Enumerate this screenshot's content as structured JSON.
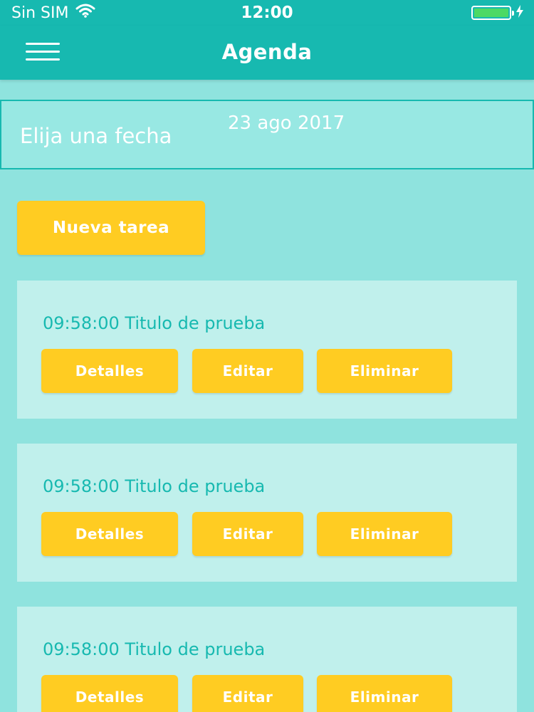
{
  "status_bar": {
    "carrier": "Sin SIM",
    "time": "12:00",
    "wifi_icon": "wifi-icon",
    "battery_icon": "battery-icon",
    "charging_icon": "lightning-icon",
    "battery_level": 1.0
  },
  "header": {
    "title": "Agenda",
    "menu_icon": "hamburger-menu-icon"
  },
  "date_picker": {
    "label": "Elija una fecha",
    "value": "23 ago 2017"
  },
  "new_task_button": {
    "label": "Nueva tarea"
  },
  "tasks": [
    {
      "title": "09:58:00 Titulo de prueba",
      "details_label": "Detalles",
      "edit_label": "Editar",
      "delete_label": "Eliminar"
    },
    {
      "title": "09:58:00 Titulo de prueba",
      "details_label": "Detalles",
      "edit_label": "Editar",
      "delete_label": "Eliminar"
    },
    {
      "title": "09:58:00 Titulo de prueba",
      "details_label": "Detalles",
      "edit_label": "Editar",
      "delete_label": "Eliminar"
    }
  ],
  "colors": {
    "primary": "#17b9b0",
    "background": "#8fe3de",
    "card": "#c0f0ec",
    "button": "#ffcc22",
    "battery": "#4cd964"
  }
}
